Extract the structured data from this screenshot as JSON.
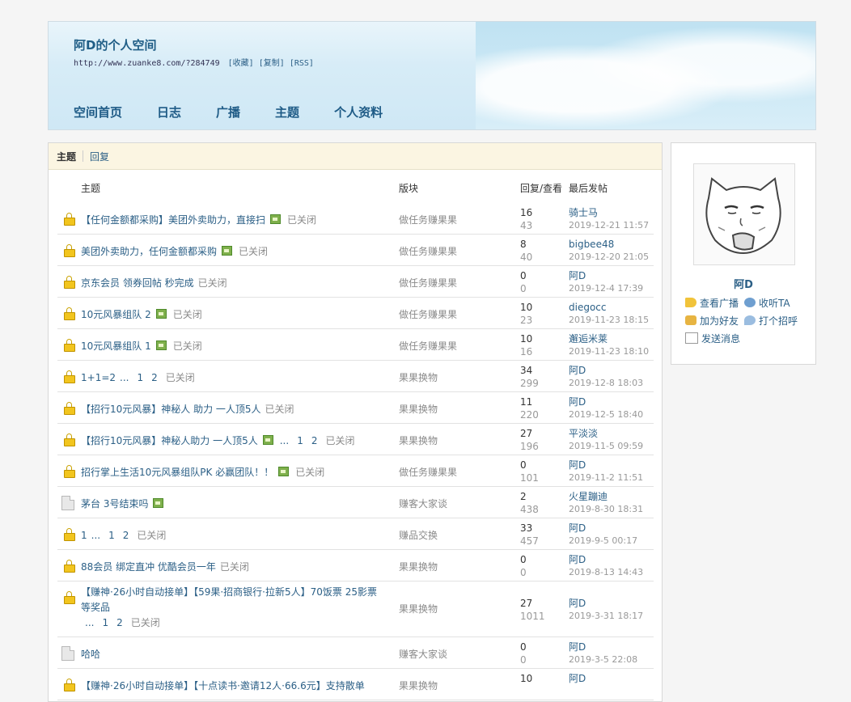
{
  "header": {
    "title": "阿D的个人空间",
    "url": "http://www.zuanke8.com/?284749",
    "links": [
      "[收藏]",
      "[复制]",
      "[RSS]"
    ],
    "nav": [
      "空间首页",
      "日志",
      "广播",
      "主题",
      "个人资料"
    ]
  },
  "tabs": {
    "active": "主题",
    "other": "回复"
  },
  "table_headers": {
    "subject": "主题",
    "forum": "版块",
    "stats": "回复/查看",
    "last": "最后发帖"
  },
  "rows": [
    {
      "icon": "lock",
      "title": "【任何金额都采购】美团外卖助力，直接扫",
      "img": true,
      "pages": "",
      "closed": "已关闭",
      "forum": "做任务赚果果",
      "replies": "16",
      "views": "43",
      "user": "骑士马",
      "date": "2019-12-21 11:57"
    },
    {
      "icon": "lock",
      "title": "美团外卖助力，任何金额都采购",
      "img": true,
      "pages": "",
      "closed": "已关闭",
      "forum": "做任务赚果果",
      "replies": "8",
      "views": "40",
      "user": "bigbee48",
      "date": "2019-12-20 21:05"
    },
    {
      "icon": "lock",
      "title": "京东会员 领券回帖 秒完成",
      "img": false,
      "pages": "",
      "closed": "已关闭",
      "forum": "做任务赚果果",
      "replies": "0",
      "views": "0",
      "user": "阿D",
      "date": "2019-12-4 17:39"
    },
    {
      "icon": "lock",
      "title": "10元风暴组队 2",
      "img": true,
      "pages": "",
      "closed": "已关闭",
      "forum": "做任务赚果果",
      "replies": "10",
      "views": "23",
      "user": "diegocc",
      "date": "2019-11-23 18:15"
    },
    {
      "icon": "lock",
      "title": "10元风暴组队 1",
      "img": true,
      "pages": "",
      "closed": "已关闭",
      "forum": "做任务赚果果",
      "replies": "10",
      "views": "16",
      "user": "邂逅米莱",
      "date": "2019-11-23 18:10"
    },
    {
      "icon": "lock",
      "title": "1+1=2",
      "img": false,
      "pages": "... 1 2",
      "closed": "已关闭",
      "forum": "果果换物",
      "replies": "34",
      "views": "299",
      "user": "阿D",
      "date": "2019-12-8 18:03"
    },
    {
      "icon": "lock",
      "title": "【招行10元风暴】神秘人 助力 一人顶5人",
      "img": false,
      "pages": "",
      "closed": "已关闭",
      "forum": "果果换物",
      "replies": "11",
      "views": "220",
      "user": "阿D",
      "date": "2019-12-5 18:40"
    },
    {
      "icon": "lock",
      "title": "【招行10元风暴】神秘人助力 一人顶5人",
      "img": true,
      "pages": "... 1 2",
      "closed": "已关闭",
      "forum": "果果换物",
      "replies": "27",
      "views": "196",
      "user": "平淡淡",
      "date": "2019-11-5 09:59"
    },
    {
      "icon": "lock",
      "title": "招行掌上生活10元风暴组队PK 必赢团队！！",
      "img": true,
      "pages": "",
      "closed": "已关闭",
      "forum": "做任务赚果果",
      "replies": "0",
      "views": "101",
      "user": "阿D",
      "date": "2019-11-2 11:51"
    },
    {
      "icon": "doc",
      "title": "茅台 3号结束吗",
      "img": true,
      "pages": "",
      "closed": "",
      "forum": "赚客大家谈",
      "replies": "2",
      "views": "438",
      "user": "火星蹦迪",
      "date": "2019-8-30 18:31"
    },
    {
      "icon": "lock",
      "title": "1",
      "img": false,
      "pages": "... 1 2",
      "closed": "已关闭",
      "forum": "赚品交换",
      "replies": "33",
      "views": "457",
      "user": "阿D",
      "date": "2019-9-5 00:17"
    },
    {
      "icon": "lock",
      "title": "88会员 绑定直冲 优酷会员一年",
      "img": false,
      "pages": "",
      "closed": "已关闭",
      "forum": "果果换物",
      "replies": "0",
      "views": "0",
      "user": "阿D",
      "date": "2019-8-13 14:43"
    },
    {
      "icon": "lock",
      "title": "【赚神·26小时自动接单】【59果·招商银行·拉新5人】70饭票 25影票等奖品",
      "img": false,
      "pages": "... 1 2",
      "closed": "已关闭",
      "forum": "果果换物",
      "replies": "27",
      "views": "1011",
      "user": "阿D",
      "date": "2019-3-31 18:17",
      "tall": true
    },
    {
      "icon": "doc",
      "title": "哈哈",
      "img": false,
      "pages": "",
      "closed": "",
      "forum": "赚客大家谈",
      "replies": "0",
      "views": "0",
      "user": "阿D",
      "date": "2019-3-5 22:08"
    },
    {
      "icon": "lock",
      "title": "【赚神·26小时自动接单】【十点读书·邀请12人·66.6元】支持散单",
      "img": false,
      "pages": "",
      "closed": "",
      "forum": "果果换物",
      "replies": "10",
      "views": "",
      "user": "阿D",
      "date": ""
    }
  ],
  "sidebar": {
    "username": "阿D",
    "actions": [
      {
        "label": "查看广播",
        "icon": "broadcast-icon"
      },
      {
        "label": "收听TA",
        "icon": "listen-icon"
      },
      {
        "label": "加为好友",
        "icon": "add-friend-icon"
      },
      {
        "label": "打个招呼",
        "icon": "greet-icon"
      },
      {
        "label": "发送消息",
        "icon": "message-icon"
      }
    ]
  }
}
